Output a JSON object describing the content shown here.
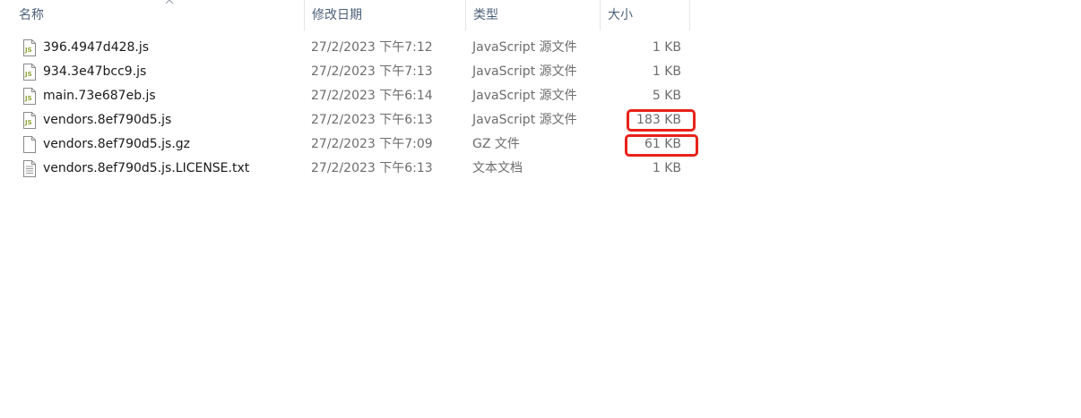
{
  "columns": {
    "name": "名称",
    "date": "修改日期",
    "type": "类型",
    "size": "大小"
  },
  "sort": {
    "column": "name",
    "direction": "ascending"
  },
  "files": [
    {
      "icon": "js-file-icon",
      "name": "396.4947d428.js",
      "date": "27/2/2023 下午7:12",
      "type": "JavaScript 源文件",
      "size": "1 KB"
    },
    {
      "icon": "js-file-icon",
      "name": "934.3e47bcc9.js",
      "date": "27/2/2023 下午7:13",
      "type": "JavaScript 源文件",
      "size": "1 KB"
    },
    {
      "icon": "js-file-icon",
      "name": "main.73e687eb.js",
      "date": "27/2/2023 下午6:14",
      "type": "JavaScript 源文件",
      "size": "5 KB"
    },
    {
      "icon": "js-file-icon",
      "name": "vendors.8ef790d5.js",
      "date": "27/2/2023 下午6:13",
      "type": "JavaScript 源文件",
      "size": "183 KB"
    },
    {
      "icon": "blank-file-icon",
      "name": "vendors.8ef790d5.js.gz",
      "date": "27/2/2023 下午7:09",
      "type": "GZ 文件",
      "size": "61 KB"
    },
    {
      "icon": "text-file-icon",
      "name": "vendors.8ef790d5.js.LICENSE.txt",
      "date": "27/2/2023 下午6:13",
      "type": "文本文档",
      "size": "1 KB"
    }
  ],
  "annotations": {
    "highlight_color": "#e8221a",
    "highlighted_sizes": [
      "183 KB",
      "61 KB"
    ]
  },
  "colors": {
    "header_text": "#4c607a",
    "js_icon_accent": "#8aa631",
    "secondary_text": "#6d6d6d"
  }
}
